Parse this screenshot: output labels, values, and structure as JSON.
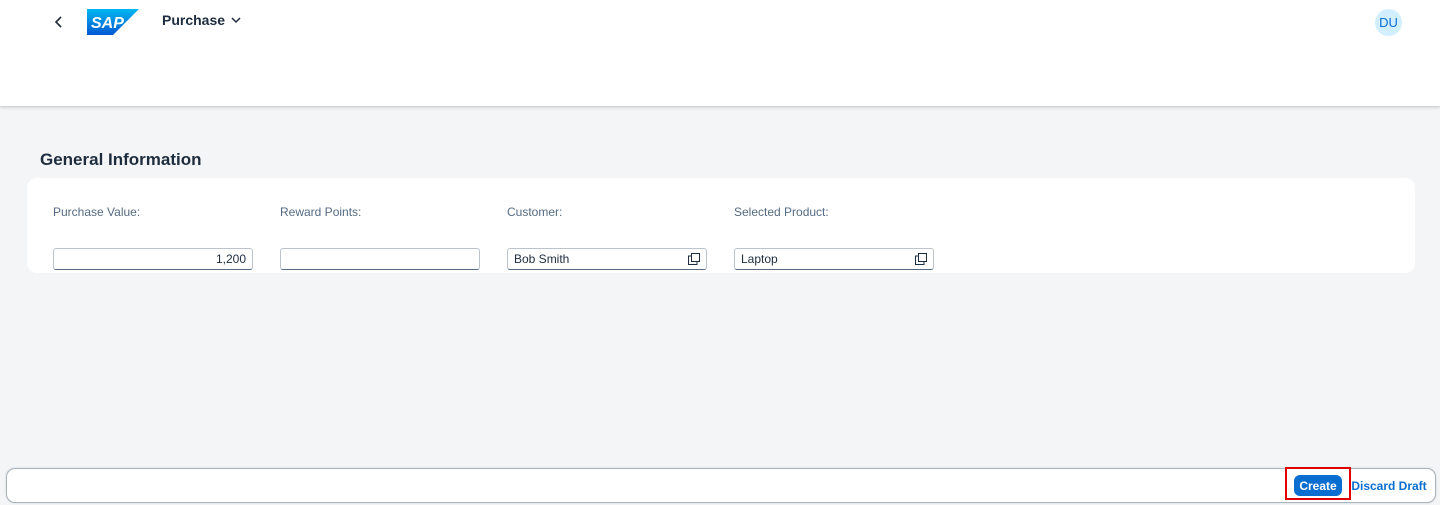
{
  "shell": {
    "logo_text": "SAP",
    "app_title": "Purchase",
    "user_initials": "DU",
    "icons": {
      "back": "chevron-left-icon",
      "title_menu": "chevron-down-icon",
      "value_help": "value-help-icon"
    }
  },
  "section": {
    "title": "General Information"
  },
  "fields": {
    "purchase_value": {
      "label": "Purchase Value:",
      "value": "1,200"
    },
    "reward_points": {
      "label": "Reward Points:",
      "value": ""
    },
    "customer": {
      "label": "Customer:",
      "value": "Bob Smith"
    },
    "selected_product": {
      "label": "Selected Product:",
      "value": "Laptop"
    }
  },
  "footer": {
    "create_label": "Create",
    "discard_label": "Discard Draft"
  },
  "colors": {
    "brand": "#0a6ed1",
    "highlight": "#e00000",
    "background": "#f4f5f7",
    "avatar_bg": "#d1efff"
  }
}
